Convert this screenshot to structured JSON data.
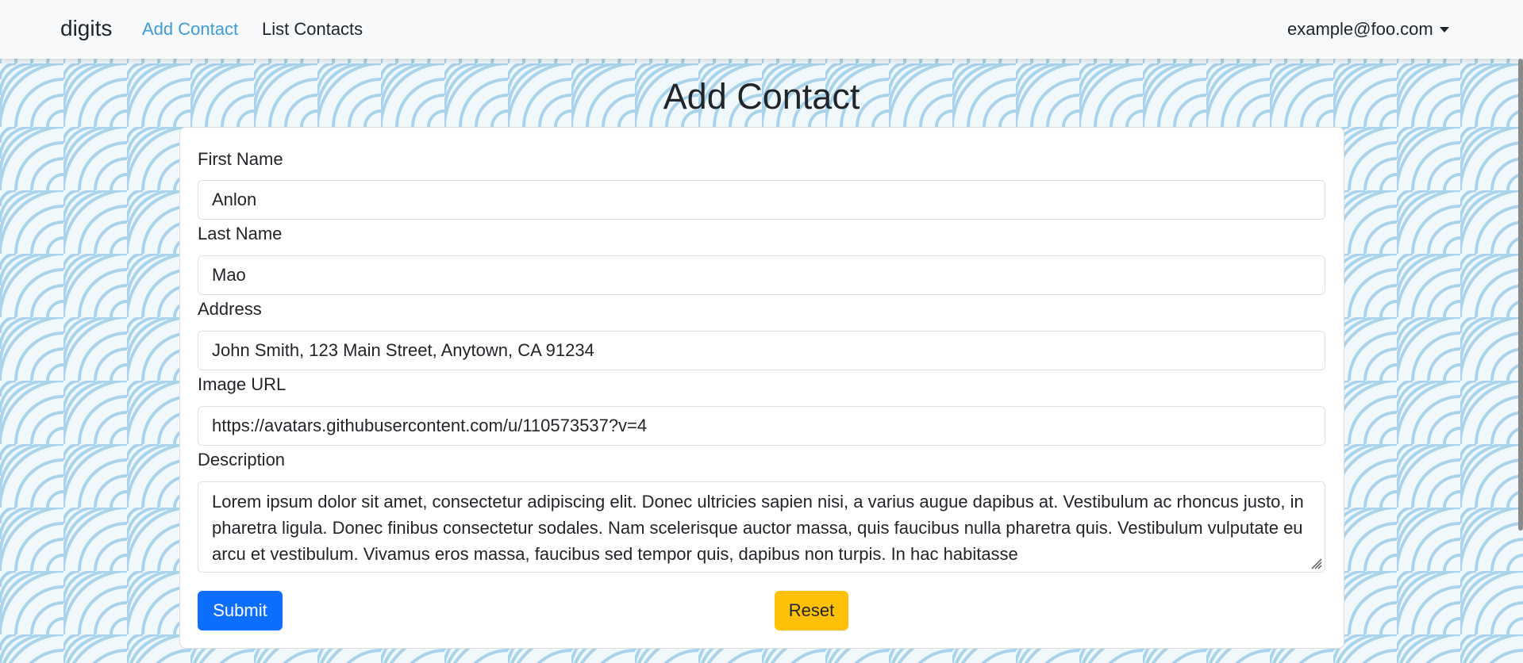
{
  "navbar": {
    "brand": "digits",
    "links": [
      {
        "label": "Add Contact",
        "active": true
      },
      {
        "label": "List Contacts",
        "active": false
      }
    ],
    "user": "example@foo.com"
  },
  "page": {
    "title": "Add Contact"
  },
  "form": {
    "first_name": {
      "label": "First Name",
      "value": "Anlon"
    },
    "last_name": {
      "label": "Last Name",
      "value": "Mao"
    },
    "address": {
      "label": "Address",
      "value": "John Smith, 123 Main Street, Anytown, CA 91234"
    },
    "image_url": {
      "label": "Image URL",
      "value": "https://avatars.githubusercontent.com/u/110573537?v=4"
    },
    "description": {
      "label": "Description",
      "value": "Lorem ipsum dolor sit amet, consectetur adipiscing elit. Donec ultricies sapien nisi, a varius augue dapibus at. Vestibulum ac rhoncus justo, in pharetra ligula. Donec finibus consectetur sodales. Nam scelerisque auctor massa, quis faucibus nulla pharetra quis. Vestibulum vulputate eu arcu et vestibulum. Vivamus eros massa, faucibus sed tempor quis, dapibus non turpis. In hac habitasse"
    },
    "submit_label": "Submit",
    "reset_label": "Reset"
  },
  "colors": {
    "active_link": "#3d9bd6",
    "submit_button": "#0d6efd",
    "reset_button": "#ffc107",
    "pattern_stroke": "#a9d3ea"
  }
}
